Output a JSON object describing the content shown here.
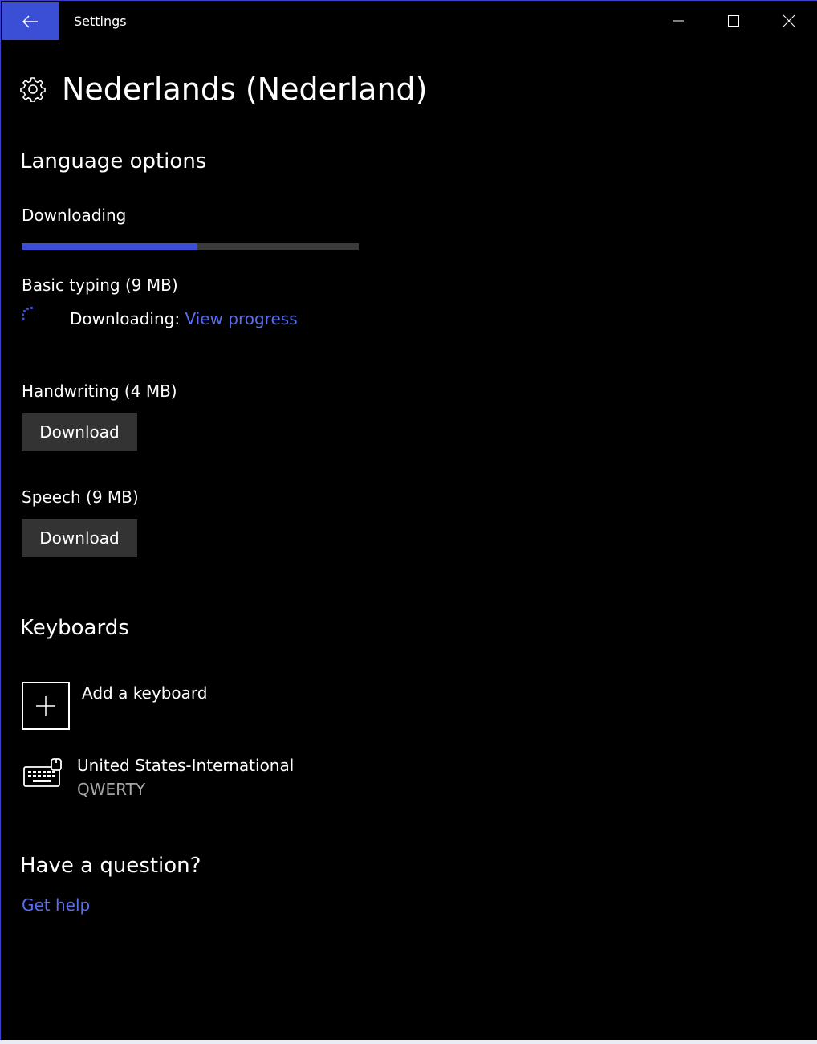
{
  "window": {
    "title": "Settings",
    "accent": "#3a4fd6",
    "link_color": "#5a6ef2"
  },
  "header": {
    "icon": "gear-icon",
    "title": "Nederlands (Nederland)"
  },
  "language_options": {
    "heading": "Language options",
    "status": "Downloading",
    "progress_percent": 52,
    "basic_typing": {
      "label": "Basic typing (9 MB)",
      "status_text": "Downloading:",
      "link": "View progress"
    },
    "handwriting": {
      "label": "Handwriting (4 MB)",
      "button": "Download"
    },
    "speech": {
      "label": "Speech (9 MB)",
      "button": "Download"
    }
  },
  "keyboards": {
    "heading": "Keyboards",
    "add_label": "Add a keyboard",
    "items": [
      {
        "name": "United States-International",
        "layout": "QWERTY",
        "icon": "keyboard-icon"
      }
    ]
  },
  "help": {
    "heading": "Have a question?",
    "link": "Get help"
  }
}
